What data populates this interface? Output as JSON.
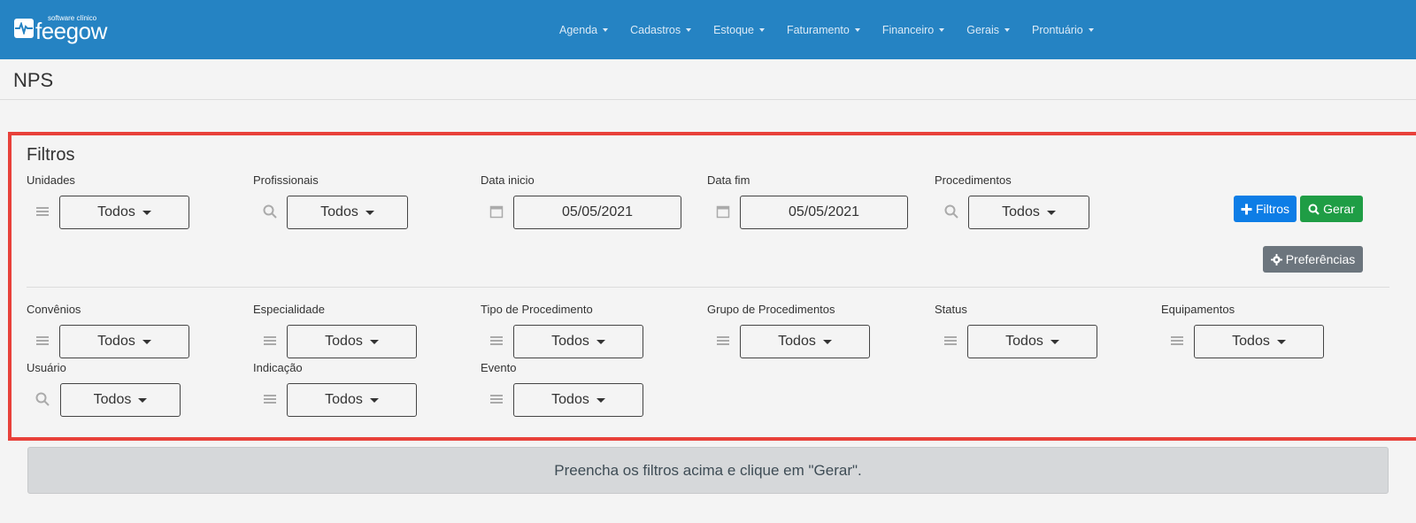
{
  "brand": {
    "name": "feegow",
    "tagline": "software clínico"
  },
  "nav": [
    {
      "label": "Agenda"
    },
    {
      "label": "Cadastros"
    },
    {
      "label": "Estoque"
    },
    {
      "label": "Faturamento"
    },
    {
      "label": "Financeiro"
    },
    {
      "label": "Gerais"
    },
    {
      "label": "Prontuário"
    }
  ],
  "page": {
    "title": "NPS"
  },
  "filters": {
    "heading": "Filtros",
    "row1": [
      {
        "label": "Unidades",
        "value": "Todos",
        "icon": "list-icon"
      },
      {
        "label": "Profissionais",
        "value": "Todos",
        "icon": "search-icon"
      },
      {
        "label": "Data inicio",
        "value": "05/05/2021",
        "icon": "calendar-icon"
      },
      {
        "label": "Data fim",
        "value": "05/05/2021",
        "icon": "calendar-icon"
      },
      {
        "label": "Procedimentos",
        "value": "Todos",
        "icon": "search-icon"
      }
    ],
    "row2": [
      {
        "label": "Convênios",
        "value": "Todos",
        "icon": "list-icon"
      },
      {
        "label": "Especialidade",
        "value": "Todos",
        "icon": "list-icon"
      },
      {
        "label": "Tipo de Procedimento",
        "value": "Todos",
        "icon": "list-icon"
      },
      {
        "label": "Grupo de Procedimentos",
        "value": "Todos",
        "icon": "list-icon"
      },
      {
        "label": "Status",
        "value": "Todos",
        "icon": "list-icon"
      },
      {
        "label": "Equipamentos",
        "value": "Todos",
        "icon": "list-icon"
      }
    ],
    "row3": [
      {
        "label": "Usuário",
        "value": "Todos",
        "icon": "search-icon"
      },
      {
        "label": "Indicação",
        "value": "Todos",
        "icon": "list-icon"
      },
      {
        "label": "Evento",
        "value": "Todos",
        "icon": "list-icon"
      }
    ]
  },
  "buttons": {
    "filtros": "Filtros",
    "gerar": "Gerar",
    "preferencias": "Preferências"
  },
  "notice": "Preencha os filtros acima e clique em \"Gerar\".",
  "colors": {
    "topbar": "#2583c3",
    "highlight_border": "#e8413a",
    "primary": "#0d7de6",
    "success": "#1f9d45",
    "secondary": "#6c757d"
  }
}
